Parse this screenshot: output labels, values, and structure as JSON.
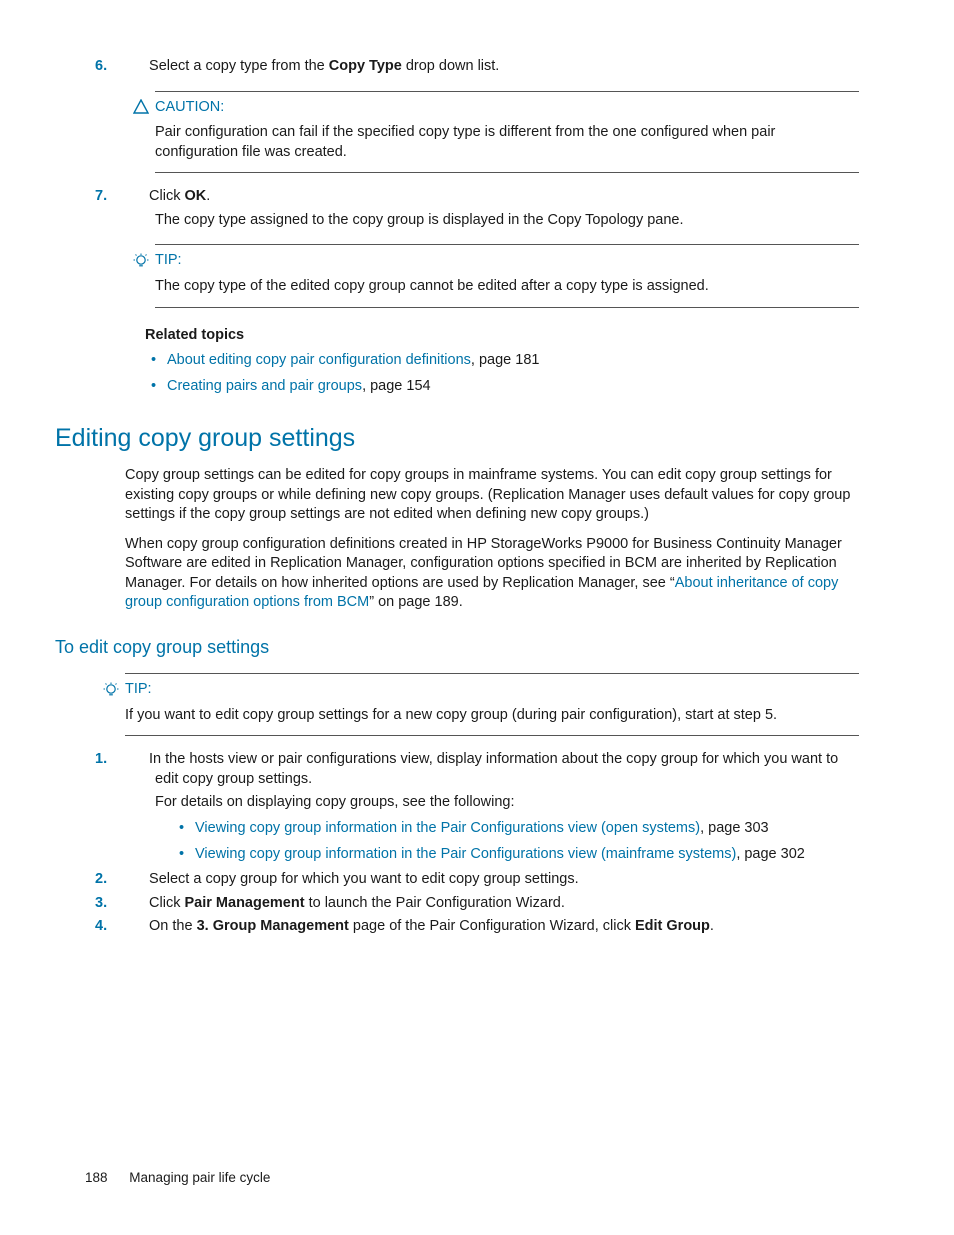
{
  "step6": {
    "num": "6.",
    "text_pre": "Select a copy type from the ",
    "bold": "Copy Type",
    "text_post": " drop down list."
  },
  "caution": {
    "label": "CAUTION:",
    "body": "Pair configuration can fail if the specified copy type is different from the one configured when pair configuration file was created."
  },
  "step7": {
    "num": "7.",
    "text_pre": "Click ",
    "bold": "OK",
    "text_post": ".",
    "under": "The copy type assigned to the copy group is displayed in the Copy Topology pane."
  },
  "tip1": {
    "label": "TIP:",
    "body": "The copy type of the edited copy group cannot be edited after a copy type is assigned."
  },
  "related": {
    "heading": "Related topics",
    "items": [
      {
        "link": "About editing copy pair configuration definitions",
        "suffix": ", page 181"
      },
      {
        "link": "Creating pairs and pair groups",
        "suffix": ", page 154"
      }
    ]
  },
  "h1": "Editing copy group settings",
  "para1": "Copy group settings can be edited for copy groups in mainframe systems. You can edit copy group settings for existing copy groups or while defining new copy groups. (Replication Manager uses default values for copy group settings if the copy group settings are not edited when defining new copy groups.)",
  "para2_pre": "When copy group configuration definitions created in HP StorageWorks P9000 for Business Continuity Manager Software are edited in Replication Manager, configuration options specified in BCM are inherited by Replication Manager. For details on how inherited options are used by Replication Manager, see “",
  "para2_link": "About inheritance of copy group configuration options from BCM",
  "para2_post": "” on page 189.",
  "h2": "To edit copy group settings",
  "tip2": {
    "label": "TIP:",
    "body": "If you want to edit copy group settings for a new copy group (during pair configuration), start at step 5."
  },
  "s1": {
    "num": "1.",
    "text": "In the hosts view or pair configurations view, display information about the copy group for which you want to edit copy group settings.",
    "under": "For details on displaying copy groups, see the following:",
    "sub": [
      {
        "link": "Viewing copy group information in the Pair Configurations view (open systems)",
        "suffix": ", page 303"
      },
      {
        "link": "Viewing copy group information in the Pair Configurations view (mainframe systems)",
        "suffix": ", page 302"
      }
    ]
  },
  "s2": {
    "num": "2.",
    "text": "Select a copy group for which you want to edit copy group settings."
  },
  "s3": {
    "num": "3.",
    "pre": "Click ",
    "b1": "Pair Management",
    "post": " to launch the Pair Configuration Wizard."
  },
  "s4": {
    "num": "4.",
    "pre": "On the ",
    "b1": "3. Group Management",
    "mid": " page of the Pair Configuration Wizard, click ",
    "b2": "Edit Group",
    "post": "."
  },
  "footer": {
    "page": "188",
    "title": "Managing pair life cycle"
  }
}
